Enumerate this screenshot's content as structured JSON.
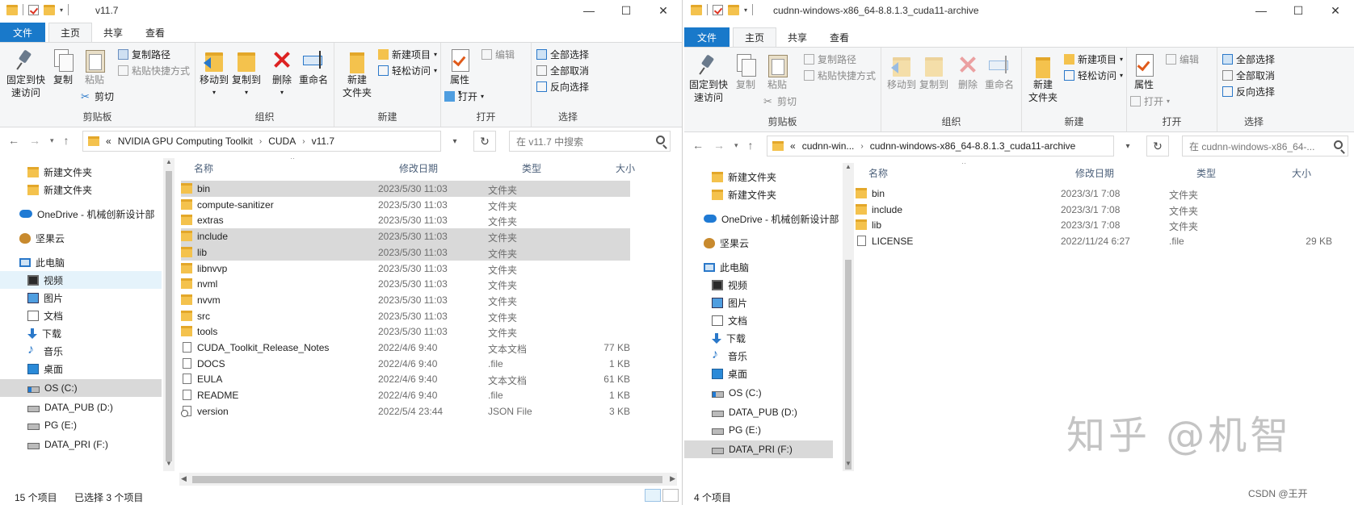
{
  "w1": {
    "title": "v11.7",
    "tabs": [
      "文件",
      "主页",
      "共享",
      "查看"
    ],
    "ribbon": {
      "pin": "固定到快\n速访问",
      "copy": "复制",
      "paste": "粘贴",
      "copy_path": "复制路径",
      "paste_shortcut": "粘贴快捷方式",
      "cut": "剪切",
      "clipboard": "剪贴板",
      "move_to": "移动到",
      "copy_to": "复制到",
      "delete": "删除",
      "rename": "重命名",
      "organize": "组织",
      "new_folder": "新建\n文件夹",
      "new_item": "新建项目",
      "easy_access": "轻松访问",
      "new": "新建",
      "properties": "属性",
      "open": "打开",
      "edit": "编辑",
      "open_group": "打开",
      "select_all": "全部选择",
      "select_none": "全部取消",
      "invert": "反向选择",
      "select": "选择"
    },
    "address": [
      "NVIDIA GPU Computing Toolkit",
      "CUDA",
      "v11.7"
    ],
    "address_prefix": "«",
    "search_placeholder": "在 v11.7 中搜索",
    "tree": [
      {
        "label": "新建文件夹",
        "icon": "folder-icon"
      },
      {
        "label": "新建文件夹",
        "icon": "folder-icon"
      },
      {
        "label": "OneDrive - 机械创新设计部",
        "icon": "cloud-icon"
      },
      {
        "label": "坚果云",
        "icon": "nut-icon"
      },
      {
        "label": "此电脑",
        "icon": "pc-icon"
      },
      {
        "label": "视频",
        "icon": "video-icon"
      },
      {
        "label": "图片",
        "icon": "picture-icon"
      },
      {
        "label": "文档",
        "icon": "document-icon"
      },
      {
        "label": "下载",
        "icon": "download-icon"
      },
      {
        "label": "音乐",
        "icon": "music-icon"
      },
      {
        "label": "桌面",
        "icon": "desktop-icon"
      },
      {
        "label": "OS (C:)",
        "icon": "os-drive-icon"
      },
      {
        "label": "DATA_PUB (D:)",
        "icon": "drive-icon"
      },
      {
        "label": "PG (E:)",
        "icon": "drive-icon"
      },
      {
        "label": "DATA_PRI (F:)",
        "icon": "drive-icon"
      }
    ],
    "columns": [
      "名称",
      "修改日期",
      "类型",
      "大小"
    ],
    "files": [
      {
        "name": "bin",
        "date": "2023/5/30 11:03",
        "type": "文件夹",
        "size": "",
        "kind": "folder",
        "selected": true
      },
      {
        "name": "compute-sanitizer",
        "date": "2023/5/30 11:03",
        "type": "文件夹",
        "size": "",
        "kind": "folder",
        "selected": false
      },
      {
        "name": "extras",
        "date": "2023/5/30 11:03",
        "type": "文件夹",
        "size": "",
        "kind": "folder",
        "selected": false
      },
      {
        "name": "include",
        "date": "2023/5/30 11:03",
        "type": "文件夹",
        "size": "",
        "kind": "folder",
        "selected": true
      },
      {
        "name": "lib",
        "date": "2023/5/30 11:03",
        "type": "文件夹",
        "size": "",
        "kind": "folder",
        "selected": true
      },
      {
        "name": "libnvvp",
        "date": "2023/5/30 11:03",
        "type": "文件夹",
        "size": "",
        "kind": "folder",
        "selected": false
      },
      {
        "name": "nvml",
        "date": "2023/5/30 11:03",
        "type": "文件夹",
        "size": "",
        "kind": "folder",
        "selected": false
      },
      {
        "name": "nvvm",
        "date": "2023/5/30 11:03",
        "type": "文件夹",
        "size": "",
        "kind": "folder",
        "selected": false
      },
      {
        "name": "src",
        "date": "2023/5/30 11:03",
        "type": "文件夹",
        "size": "",
        "kind": "folder",
        "selected": false
      },
      {
        "name": "tools",
        "date": "2023/5/30 11:03",
        "type": "文件夹",
        "size": "",
        "kind": "folder",
        "selected": false
      },
      {
        "name": "CUDA_Toolkit_Release_Notes",
        "date": "2022/4/6 9:40",
        "type": "文本文档",
        "size": "77 KB",
        "kind": "file",
        "selected": false
      },
      {
        "name": "DOCS",
        "date": "2022/4/6 9:40",
        "type": ".file",
        "size": "1 KB",
        "kind": "file",
        "selected": false
      },
      {
        "name": "EULA",
        "date": "2022/4/6 9:40",
        "type": "文本文档",
        "size": "61 KB",
        "kind": "file",
        "selected": false
      },
      {
        "name": "README",
        "date": "2022/4/6 9:40",
        "type": ".file",
        "size": "1 KB",
        "kind": "file",
        "selected": false
      },
      {
        "name": "version",
        "date": "2022/5/4 23:44",
        "type": "JSON File",
        "size": "3 KB",
        "kind": "json",
        "selected": false
      }
    ],
    "status_count": "15 个项目",
    "status_selected": "已选择 3 个项目"
  },
  "w2": {
    "title": "cudnn-windows-x86_64-8.8.1.3_cuda11-archive",
    "tabs": [
      "文件",
      "主页",
      "共享",
      "查看"
    ],
    "address": [
      "cudnn-win...",
      "cudnn-windows-x86_64-8.8.1.3_cuda11-archive"
    ],
    "address_prefix": "«",
    "search_placeholder": "在 cudnn-windows-x86_64-...",
    "files": [
      {
        "name": "bin",
        "date": "2023/3/1 7:08",
        "type": "文件夹",
        "size": "",
        "kind": "folder"
      },
      {
        "name": "include",
        "date": "2023/3/1 7:08",
        "type": "文件夹",
        "size": "",
        "kind": "folder"
      },
      {
        "name": "lib",
        "date": "2023/3/1 7:08",
        "type": "文件夹",
        "size": "",
        "kind": "folder"
      },
      {
        "name": "LICENSE",
        "date": "2022/11/24 6:27",
        "type": ".file",
        "size": "29 KB",
        "kind": "file"
      }
    ],
    "status_count": "4 个项目"
  },
  "watermark": "知乎 @机智",
  "csdn": "CSDN @王开"
}
